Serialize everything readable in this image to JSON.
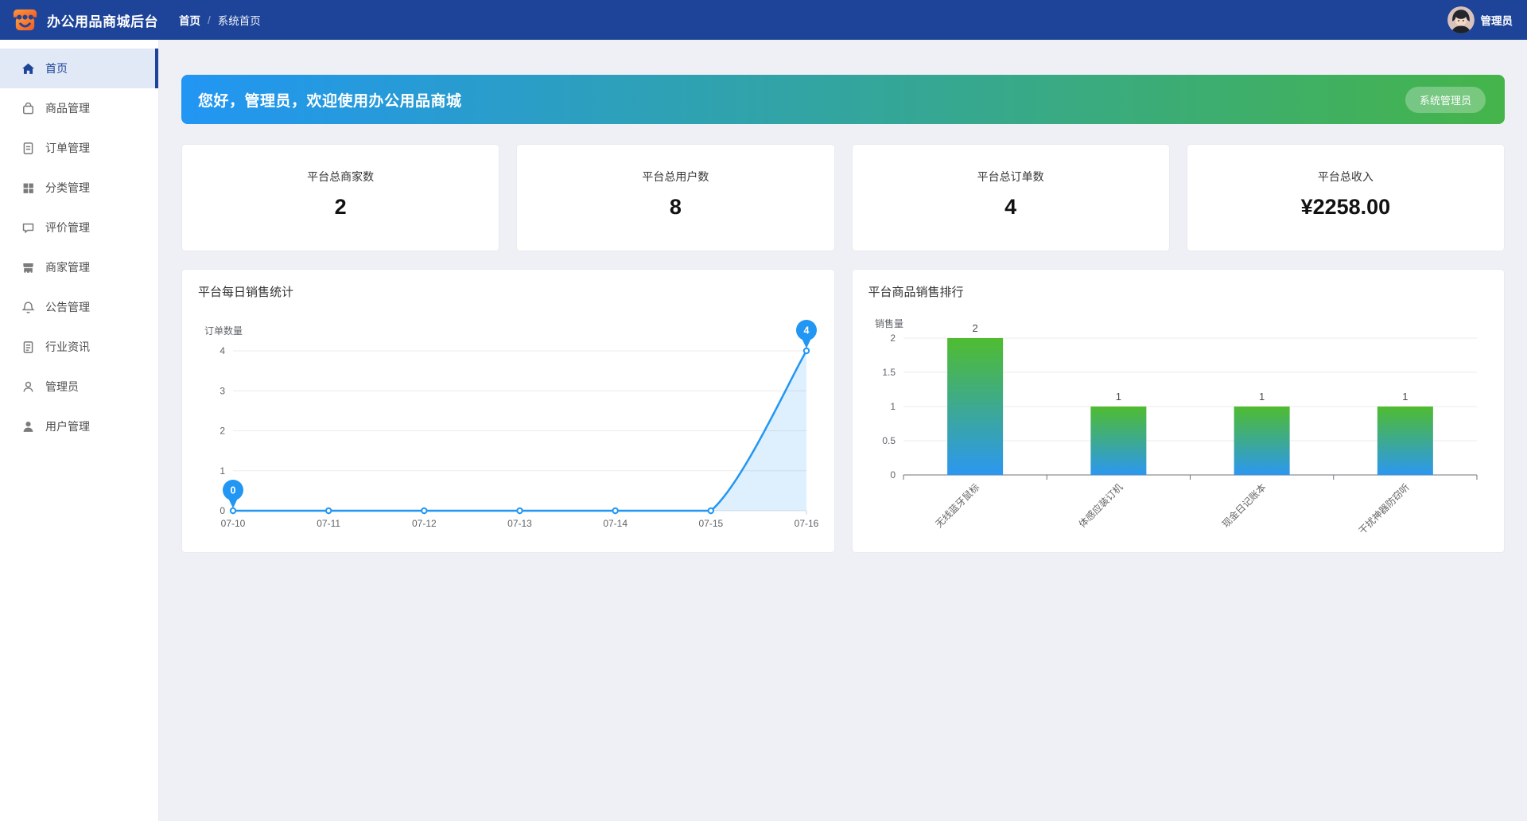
{
  "navbar": {
    "title": "办公用品商城后台",
    "logo_icon": "storefront-smile-icon",
    "breadcrumb": [
      "首页",
      "系统首页"
    ],
    "breadcrumb_separator": "/",
    "user": "管理员",
    "bg_color": "#1d4499"
  },
  "sidebar": {
    "items": [
      {
        "label": "首页",
        "icon": "home-icon",
        "active": true
      },
      {
        "label": "商品管理",
        "icon": "shopping-bag-icon",
        "active": false
      },
      {
        "label": "订单管理",
        "icon": "order-document-icon",
        "active": false
      },
      {
        "label": "分类管理",
        "icon": "grid-icon",
        "active": false
      },
      {
        "label": "评价管理",
        "icon": "chat-bubble-icon",
        "active": false
      },
      {
        "label": "商家管理",
        "icon": "storefront-icon",
        "active": false
      },
      {
        "label": "公告管理",
        "icon": "bell-icon",
        "active": false
      },
      {
        "label": "行业资讯",
        "icon": "news-document-icon",
        "active": false
      },
      {
        "label": "管理员",
        "icon": "person-outline-icon",
        "active": false
      },
      {
        "label": "用户管理",
        "icon": "person-filled-icon",
        "active": false
      }
    ]
  },
  "banner": {
    "greeting": "您好，管理员，欢迎使用办公用品商城",
    "role_badge": "系统管理员",
    "gradient": [
      "#2196f3",
      "#45b44a"
    ]
  },
  "stats": [
    {
      "label": "平台总商家数",
      "value": "2"
    },
    {
      "label": "平台总用户数",
      "value": "8"
    },
    {
      "label": "平台总订单数",
      "value": "4"
    },
    {
      "label": "平台总收入",
      "value": "¥2258.00"
    }
  ],
  "chart_data": [
    {
      "type": "line",
      "title": "平台每日销售统计",
      "ylabel": "订单数量",
      "x": [
        "07-10",
        "07-11",
        "07-12",
        "07-13",
        "07-14",
        "07-15",
        "07-16"
      ],
      "values": [
        0,
        0,
        0,
        0,
        0,
        0,
        4
      ],
      "ylim": [
        0,
        4
      ],
      "yticks": [
        0,
        1,
        2,
        3,
        4
      ],
      "grid": true,
      "legend_position": "none",
      "mark_points": [
        {
          "index": 0,
          "label": "0"
        },
        {
          "index": 6,
          "label": "4"
        }
      ],
      "line_color": "#2196f3",
      "area_color": "rgba(33,150,243,0.15)"
    },
    {
      "type": "bar",
      "title": "平台商品销售排行",
      "ylabel": "销售量",
      "categories": [
        "无线蓝牙鼠标",
        "体感应装订机",
        "现金日记账本",
        "干扰神器防窃听"
      ],
      "values": [
        2,
        1,
        1,
        1
      ],
      "ylim": [
        0,
        2
      ],
      "yticks": [
        0,
        0.5,
        1,
        1.5,
        2
      ],
      "grid": true,
      "legend_position": "none",
      "bar_gradient": [
        "#4fbc30",
        "#2c97f0"
      ]
    }
  ]
}
